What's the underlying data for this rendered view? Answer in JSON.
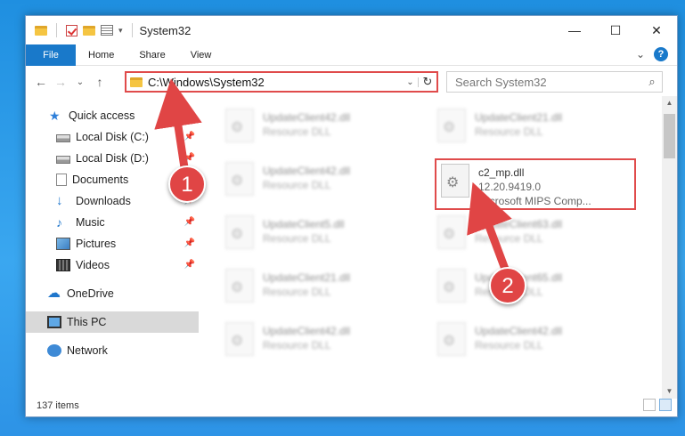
{
  "window": {
    "title": "System32",
    "controls": {
      "minimize": "—",
      "maximize": "☐",
      "close": "✕"
    }
  },
  "ribbon": {
    "tabs": [
      "File",
      "Home",
      "Share",
      "View"
    ],
    "expand_icon": "⌄",
    "help": "?"
  },
  "navigation": {
    "back": "←",
    "forward": "→",
    "recent": "⌄",
    "up": "↑",
    "address": "C:\\Windows\\System32",
    "dropdown": "⌄",
    "refresh": "↻",
    "search_placeholder": "Search System32",
    "search_icon": "⌕"
  },
  "sidebar": {
    "items": [
      {
        "label": "Quick access",
        "icon": "star-icon",
        "pinned": false
      },
      {
        "label": "Local Disk (C:)",
        "icon": "disk-icon",
        "pinned": true
      },
      {
        "label": "Local Disk (D:)",
        "icon": "disk-icon",
        "pinned": true
      },
      {
        "label": "Documents",
        "icon": "document-icon",
        "pinned": true
      },
      {
        "label": "Downloads",
        "icon": "download-icon",
        "pinned": true
      },
      {
        "label": "Music",
        "icon": "music-icon",
        "pinned": true
      },
      {
        "label": "Pictures",
        "icon": "pictures-icon",
        "pinned": true
      },
      {
        "label": "Videos",
        "icon": "videos-icon",
        "pinned": true
      },
      {
        "label": "OneDrive",
        "icon": "cloud-icon",
        "pinned": false
      },
      {
        "label": "This PC",
        "icon": "computer-icon",
        "pinned": false,
        "selected": true
      },
      {
        "label": "Network",
        "icon": "network-icon",
        "pinned": false
      }
    ],
    "pin_glyph": "📌"
  },
  "files": {
    "left_column": [
      {
        "name": "UpdateClient42.dll",
        "desc": "Resource DLL"
      },
      {
        "name": "UpdateClient42.dll",
        "desc": "Resource DLL"
      },
      {
        "name": "UpdateClient5.dll",
        "desc": "Resource DLL"
      },
      {
        "name": "UpdateClient21.dll",
        "desc": "Resource DLL"
      },
      {
        "name": "UpdateClient42.dll",
        "desc": "Resource DLL"
      }
    ],
    "right_column": [
      {
        "name": "UpdateClient21.dll",
        "desc": "Resource DLL"
      },
      {
        "name": "UpdateClient63.dll",
        "desc": "Resource DLL"
      },
      {
        "name": "UpdateClient65.dll",
        "desc": "Resource DLL"
      },
      {
        "name": "UpdateClient42.dll",
        "desc": "Resource DLL"
      }
    ],
    "highlighted": {
      "name": "c2_mp.dll",
      "version": "12.20.9419.0",
      "company": "Microsoft MIPS Comp..."
    }
  },
  "status": {
    "items": "137 items"
  },
  "annotations": {
    "step1": "1",
    "step2": "2",
    "color": "#e04545"
  }
}
